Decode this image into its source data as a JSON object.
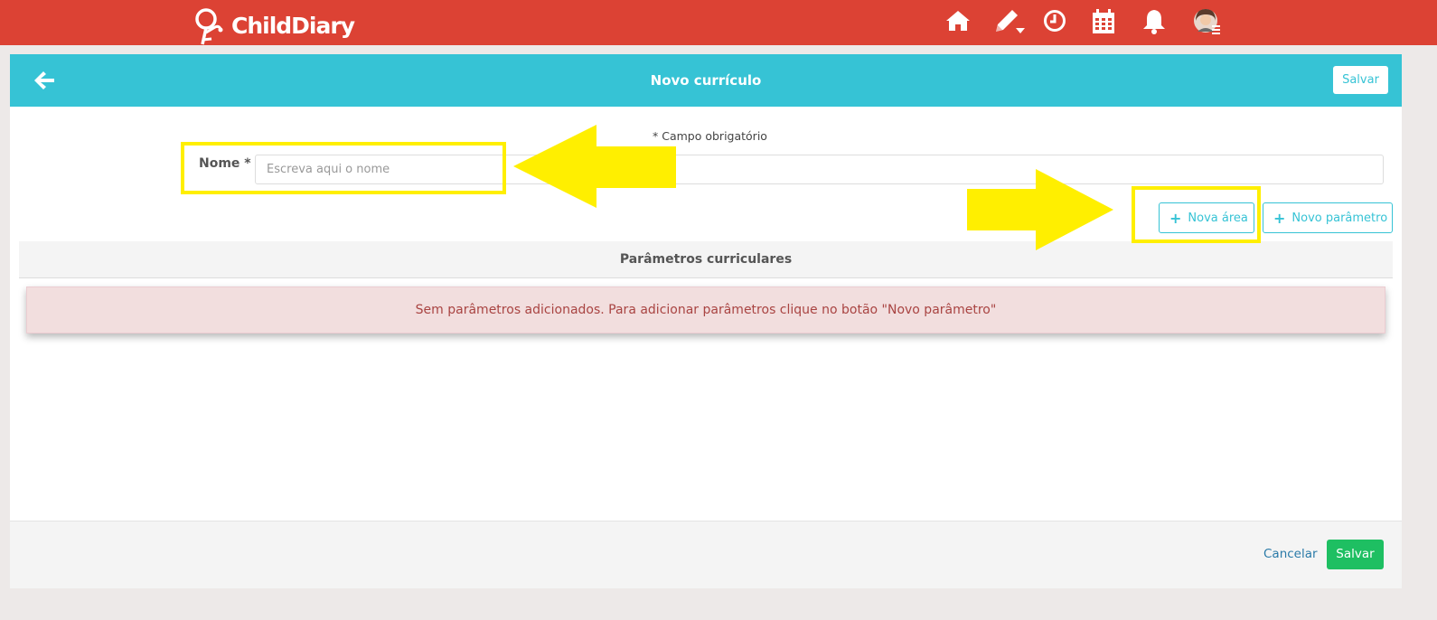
{
  "app": {
    "brand": "ChildDiary"
  },
  "nav": {
    "icons": [
      "home-icon",
      "pencil-icon",
      "clock-icon",
      "calendar-icon",
      "bell-icon",
      "avatar"
    ]
  },
  "page": {
    "title": "Novo currículo",
    "header_save": "Salvar",
    "required_note": "* Campo obrigatório"
  },
  "form": {
    "name_label": "Nome *",
    "name_value": "",
    "name_placeholder": "Escreva aqui o nome"
  },
  "actions": {
    "new_area": "Nova área",
    "new_parameter": "Novo parâmetro"
  },
  "section": {
    "title": "Parâmetros curriculares",
    "empty_message": "Sem parâmetros adicionados. Para adicionar parâmetros clique no botão \"Novo parâmetro\""
  },
  "footer": {
    "cancel": "Cancelar",
    "save": "Salvar"
  },
  "colors": {
    "topbar": "#dc4234",
    "header": "#36c3d5",
    "save_green": "#1ebf62",
    "alert_bg": "#f2dede",
    "alert_text": "#a94442",
    "annotation": "#ffef00"
  }
}
